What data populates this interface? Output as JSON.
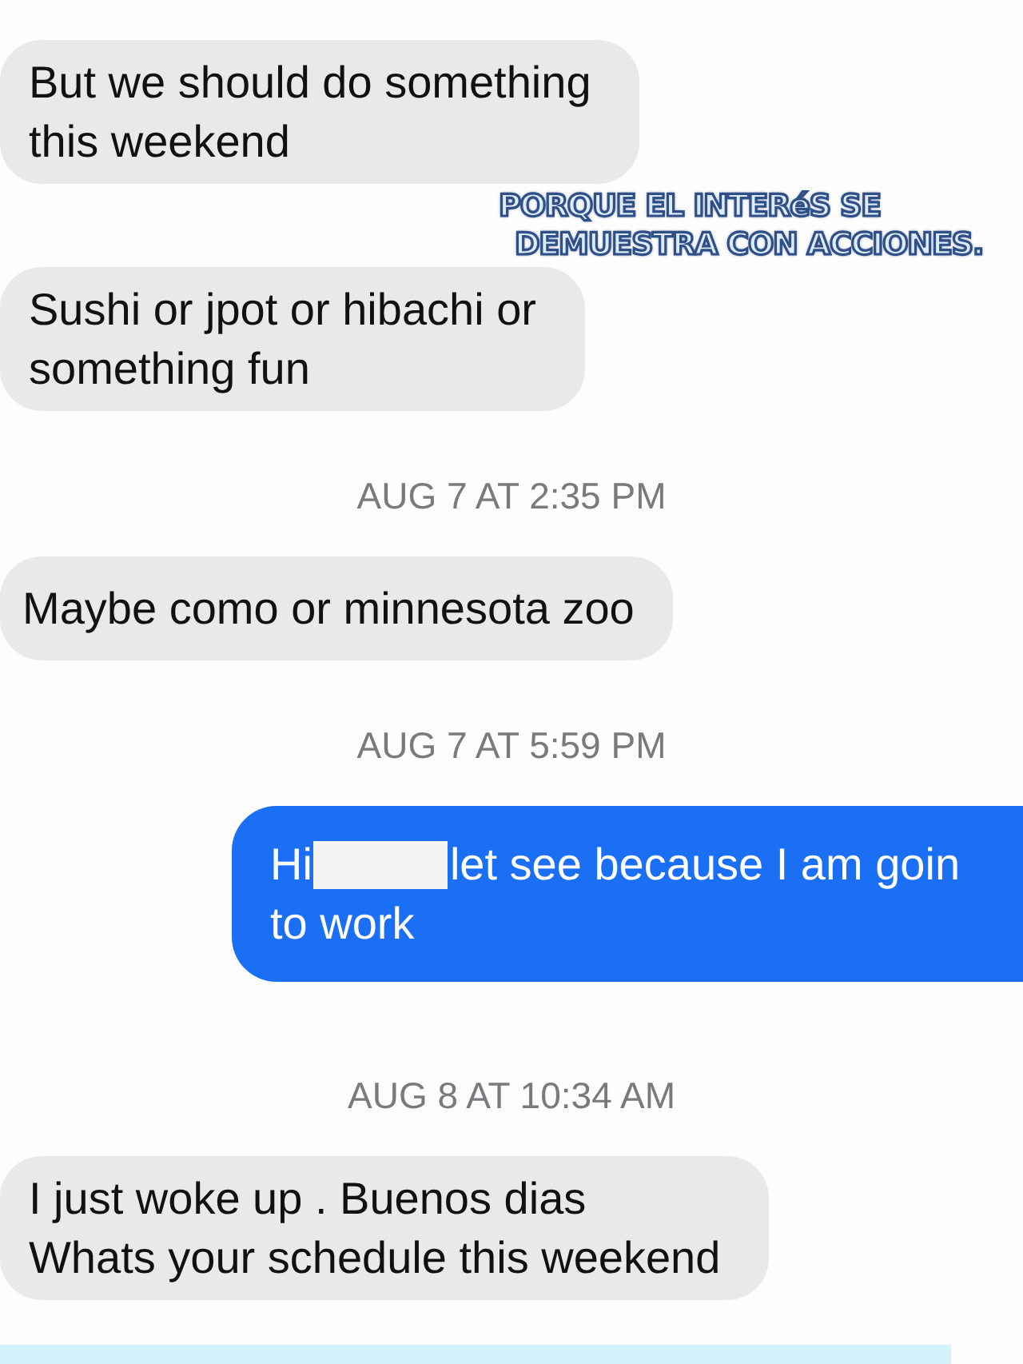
{
  "messages": [
    {
      "kind": "received",
      "lines": [
        "But we should do something",
        "this weekend"
      ]
    },
    {
      "kind": "received",
      "lines": [
        "Sushi or jpot or hibachi or",
        "something fun"
      ]
    },
    {
      "kind": "timestamp",
      "text": "AUG 7 AT 2:35 PM"
    },
    {
      "kind": "received",
      "lines": [
        "Maybe como or minnesota zoo"
      ]
    },
    {
      "kind": "timestamp",
      "text": "AUG 7 AT 5:59 PM"
    },
    {
      "kind": "sent",
      "redacted": true,
      "before": "Hi",
      "after": "let see because I am goin",
      "lines": [
        "to work"
      ]
    },
    {
      "kind": "timestamp",
      "text": "AUG 8 AT 10:34 AM"
    },
    {
      "kind": "received",
      "lines": [
        "I just woke up . Buenos dias",
        "Whats your schedule this weekend"
      ]
    },
    {
      "kind": "cut_off"
    }
  ],
  "caption": {
    "lines": [
      "PORQUE EL INTERéS SE",
      "DEMUESTRA CON ACCIONES."
    ]
  }
}
